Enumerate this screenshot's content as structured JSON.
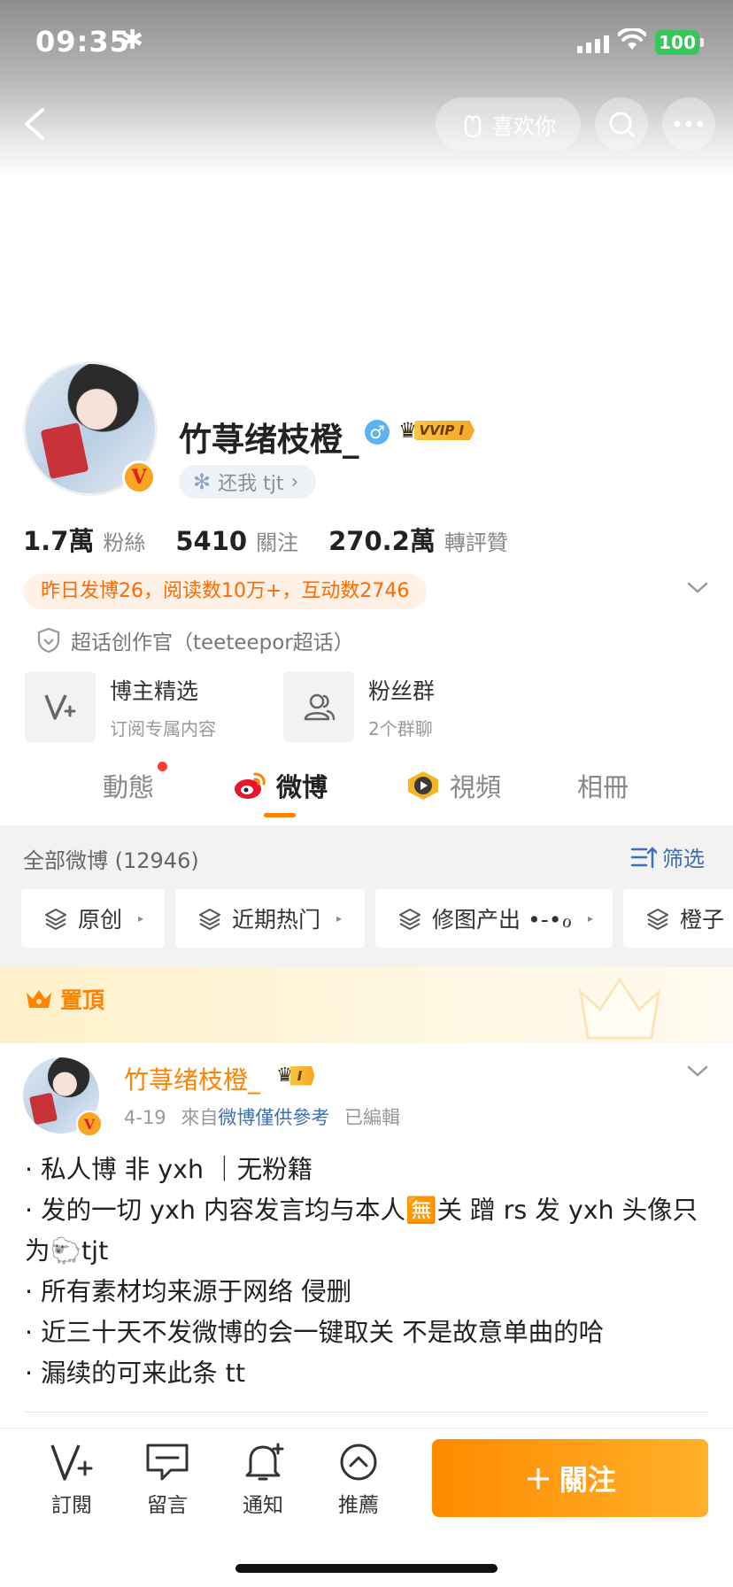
{
  "status_bar": {
    "time": "09:35",
    "extra_icon": "✱",
    "battery": "100"
  },
  "header": {
    "like_button_label": "喜欢你"
  },
  "profile": {
    "name": "竹荨绪枝橙_",
    "vip_label": "VVIP I",
    "status_text": "还我 tjt",
    "stats": [
      {
        "number": "1.7萬",
        "label": "粉絲"
      },
      {
        "number": "5410",
        "label": "關注"
      },
      {
        "number": "270.2萬",
        "label": "轉評贊"
      }
    ],
    "activity": "昨日发博26，阅读数10万+，互动数2746",
    "super_topic": "超话创作官（teeteepor超话）",
    "cards": [
      {
        "title": "博主精选",
        "subtitle": "订阅专属内容",
        "icon": "v-plus-icon"
      },
      {
        "title": "粉丝群",
        "subtitle": "2个群聊",
        "icon": "group-icon"
      }
    ]
  },
  "tabs": [
    {
      "label": "動態",
      "active": false
    },
    {
      "label": "微博",
      "active": true
    },
    {
      "label": "視頻",
      "active": false
    },
    {
      "label": "相冊",
      "active": false
    }
  ],
  "feed": {
    "count_label": "全部微博 (12946)",
    "filter_label": "筛选",
    "chips": [
      "原创",
      "近期热门",
      "修图产出 •-•ℴ",
      "橙子"
    ],
    "pinned_label": "置頂"
  },
  "post": {
    "author": "竹荨绪枝橙_",
    "vip_label": "I",
    "date": "4-19",
    "from_prefix": "來自",
    "source": "微博僅供參考",
    "edited": "已編輯",
    "lines": [
      "· 私人博 非 yxh ｜无粉籍",
      "· 发的一切 yxh 内容发言均与本人🈚关  蹭 rs 发 yxh 头像只为🐑tjt",
      "· 所有素材均来源于网络  侵删",
      "· 近三十天不发微博的会一键取关  不是故意单曲的哈",
      "· 漏续的可来此条 tt"
    ]
  },
  "bottom_bar": {
    "items": [
      {
        "label": "訂閱",
        "icon": "subscribe-icon"
      },
      {
        "label": "留言",
        "icon": "message-icon"
      },
      {
        "label": "通知",
        "icon": "bell-icon"
      },
      {
        "label": "推薦",
        "icon": "recommend-icon"
      }
    ],
    "follow_label": "關注"
  },
  "colors": {
    "accent": "#ff8200",
    "link": "#3d6fb6",
    "badge": "#f6a623"
  }
}
